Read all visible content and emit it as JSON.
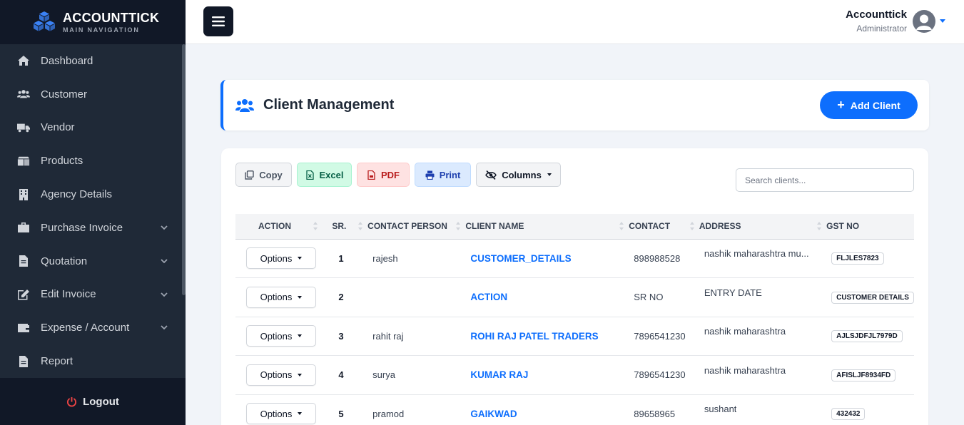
{
  "brand": {
    "name": "ACCOUNTTICK",
    "subtitle": "MAIN NAVIGATION"
  },
  "sidebar": {
    "items": [
      {
        "label": "Dashboard",
        "icon": "home-icon",
        "expandable": false
      },
      {
        "label": "Customer",
        "icon": "users-icon",
        "expandable": false
      },
      {
        "label": "Vendor",
        "icon": "truck-icon",
        "expandable": false
      },
      {
        "label": "Products",
        "icon": "boxes-icon",
        "expandable": false
      },
      {
        "label": "Agency Details",
        "icon": "building-icon",
        "expandable": false
      },
      {
        "label": "Purchase Invoice",
        "icon": "briefcase-icon",
        "expandable": true
      },
      {
        "label": "Quotation",
        "icon": "file-icon",
        "expandable": true
      },
      {
        "label": "Edit Invoice",
        "icon": "edit-icon",
        "expandable": true
      },
      {
        "label": "Expense / Account",
        "icon": "wallet-icon",
        "expandable": true
      },
      {
        "label": "Report",
        "icon": "file-icon",
        "expandable": false
      }
    ],
    "logout_label": "Logout"
  },
  "user": {
    "name": "Accounttick",
    "role": "Administrator"
  },
  "page": {
    "title": "Client Management",
    "add_button": "Add Client"
  },
  "toolbar": {
    "copy": "Copy",
    "excel": "Excel",
    "pdf": "PDF",
    "print": "Print",
    "columns": "Columns",
    "search_placeholder": "Search clients..."
  },
  "table": {
    "headers": [
      "ACTION",
      "SR.",
      "CONTACT PERSON",
      "CLIENT NAME",
      "CONTACT",
      "ADDRESS",
      "GST NO"
    ],
    "options_label": "Options",
    "rows": [
      {
        "sr": "1",
        "contact_person": "rajesh",
        "client_name": "CUSTOMER_DETAILS",
        "contact": "898988528",
        "address": "nashik maharashtra mu...",
        "gst": "FLJLES7823"
      },
      {
        "sr": "2",
        "contact_person": "",
        "client_name": "ACTION",
        "contact": "SR NO",
        "address": "ENTRY DATE",
        "gst": "CUSTOMER DETAILS"
      },
      {
        "sr": "3",
        "contact_person": "rahit raj",
        "client_name": "ROHI RAJ PATEL TRADERS",
        "contact": "7896541230",
        "address": "nashik maharashtra",
        "gst": "AJLSJDFJL7979D"
      },
      {
        "sr": "4",
        "contact_person": "surya",
        "client_name": "KUMAR RAJ",
        "contact": "7896541230",
        "address": "nashik maharashtra",
        "gst": "AFISLJF8934FD"
      },
      {
        "sr": "5",
        "contact_person": "pramod",
        "client_name": "GAIKWAD",
        "contact": "89658965",
        "address": "sushant",
        "gst": "432432"
      }
    ]
  },
  "colors": {
    "primary": "#0d6efd",
    "sidebar": "#1f2937",
    "sidebar_dark": "#111827",
    "logout_icon": "#ef4444"
  }
}
